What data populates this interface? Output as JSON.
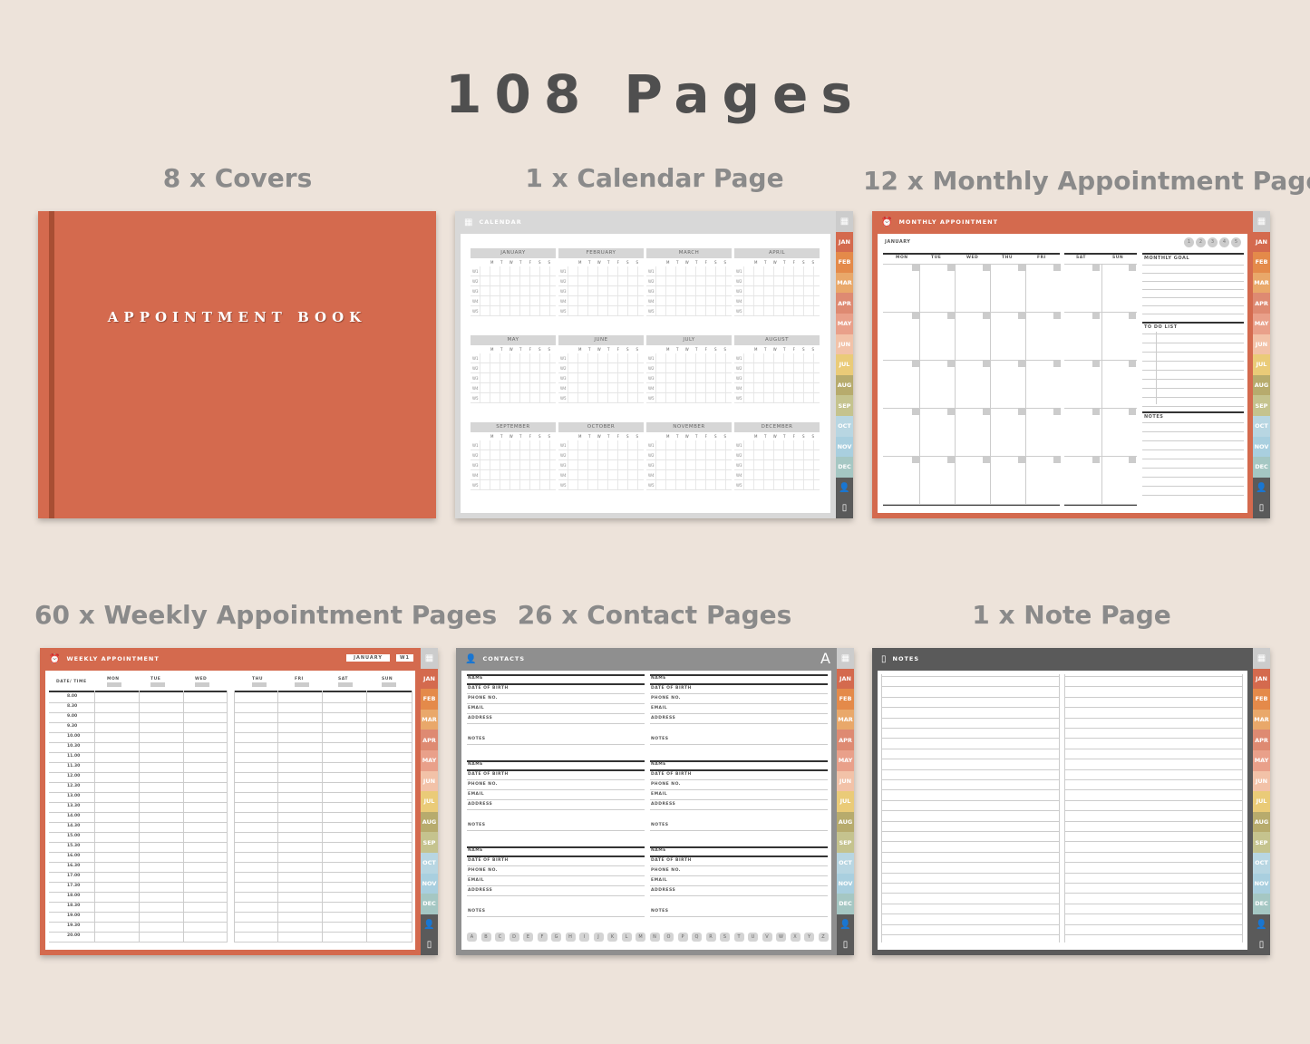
{
  "title": "108 Pages",
  "captions": {
    "covers": "8 x Covers",
    "calendar": "1 x Calendar Page",
    "monthly": "12 x Monthly Appointment Pages",
    "weekly": "60 x Weekly Appointment Pages",
    "contacts": "26 x Contact Pages",
    "notes": "1 x Note Page"
  },
  "cover": {
    "title": "APPOINTMENT BOOK",
    "color": "#d46a4e"
  },
  "calendar": {
    "header": "CALENDAR",
    "months": [
      "JANUARY",
      "FEBRUARY",
      "MARCH",
      "APRIL",
      "MAY",
      "JUNE",
      "JULY",
      "AUGUST",
      "SEPTEMBER",
      "OCTOBER",
      "NOVEMBER",
      "DECEMBER"
    ],
    "days": [
      "M",
      "T",
      "W",
      "T",
      "F",
      "S",
      "S"
    ],
    "weeks": [
      "W1",
      "W2",
      "W3",
      "W4",
      "W5"
    ]
  },
  "monthly": {
    "header": "MONTHLY APPOINTMENT",
    "month": "JANUARY",
    "days": [
      "MON",
      "TUE",
      "WED",
      "THU",
      "FRI",
      "SAT",
      "SUN"
    ],
    "badges": [
      "1",
      "2",
      "3",
      "4",
      "5"
    ],
    "monthly_goal": "MONTHLY GOAL",
    "todo": "TO DO LIST",
    "notes": "NOTES"
  },
  "weekly": {
    "header": "WEEKLY APPOINTMENT",
    "month_chip": "JANUARY",
    "week_chip": "W1",
    "date_time": "DATE/ TIME",
    "days": [
      "MON",
      "TUE",
      "WED",
      "THU",
      "FRI",
      "SAT",
      "SUN"
    ],
    "times": [
      "8.00",
      "8.30",
      "9.00",
      "9.30",
      "10.00",
      "10.30",
      "11.00",
      "11.30",
      "12.00",
      "12.30",
      "13.00",
      "13.30",
      "14.00",
      "14.30",
      "15.00",
      "15.30",
      "16.00",
      "16.30",
      "17.00",
      "17.30",
      "18.00",
      "18.30",
      "19.00",
      "19.30",
      "20.00"
    ]
  },
  "contacts": {
    "header": "CONTACTS",
    "big_letter": "A",
    "fields": [
      "NAME",
      "DATE OF BIRTH",
      "PHONE NO.",
      "EMAIL",
      "ADDRESS",
      "NOTES"
    ],
    "alphabet": [
      "A",
      "B",
      "C",
      "D",
      "E",
      "F",
      "G",
      "H",
      "I",
      "J",
      "K",
      "L",
      "M",
      "N",
      "O",
      "P",
      "Q",
      "R",
      "S",
      "T",
      "U",
      "V",
      "W",
      "X",
      "Y",
      "Z"
    ]
  },
  "notes": {
    "header": "NOTES"
  },
  "tabs": {
    "labels": [
      "JAN",
      "FEB",
      "MAR",
      "APR",
      "MAY",
      "JUN",
      "JUL",
      "AUG",
      "SEP",
      "OCT",
      "NOV",
      "DEC"
    ],
    "colors": [
      "#d46a4e",
      "#e48a4a",
      "#e9a86a",
      "#de8a72",
      "#e9a08a",
      "#f2c2a8",
      "#eacb78",
      "#b7ab6d",
      "#c5c38e",
      "#b8d6e2",
      "#a9cfdf",
      "#a5c7c3"
    ]
  },
  "colors": {
    "orange": "#d46a4e",
    "grey": "#8f8f8f",
    "dark": "#5a5a5a",
    "light": "#d8d8d8"
  }
}
